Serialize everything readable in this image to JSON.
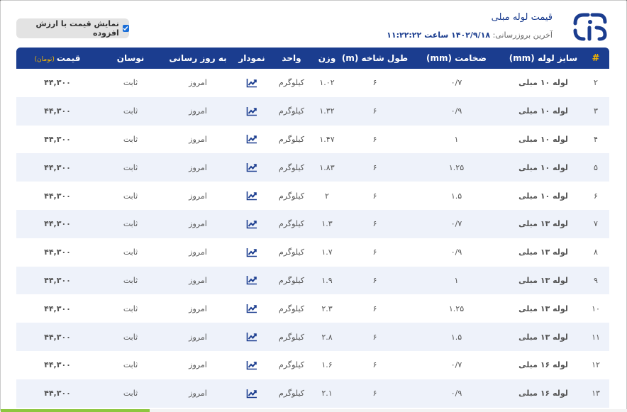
{
  "header": {
    "title": "قیمت لوله مبلی",
    "updated_label": "آخرین بروزرسانی:",
    "updated_value": "۱۴۰۲/۹/۱۸ ساعت ۱۱:۲۲:۲۲",
    "logo_icon": "company-logo-icon"
  },
  "vat_toggle": {
    "label": "نمایش قیمت با ارزش افزوده",
    "checked": true,
    "accent": "#1a6ed8"
  },
  "colors": {
    "header_bg": "#1b3d8f",
    "accent_yellow": "#f2b400",
    "row_alt": "#eef2fa",
    "chart_icon": "#1b3d8f"
  },
  "table": {
    "index_icon": "hash-icon",
    "columns": {
      "size": "سایز لوله (mm)",
      "thickness": "ضخامت (mm)",
      "length": "طول شاخه (m)",
      "weight": "وزن",
      "unit": "واحد",
      "chart": "نمودار",
      "update": "به روز رسانی",
      "change": "نوسان",
      "price": "قیمت",
      "price_unit": "(تومان)"
    },
    "rows": [
      {
        "idx": "۲",
        "size": "لوله ۱۰ مبلی",
        "thickness": "۰/۷",
        "length": "۶",
        "weight": "۱.۰۲",
        "unit": "کیلوگرم",
        "update": "امروز",
        "change": "ثابت",
        "price": "۴۴,۳۰۰"
      },
      {
        "idx": "۳",
        "size": "لوله ۱۰ مبلی",
        "thickness": "۰/۹",
        "length": "۶",
        "weight": "۱.۳۲",
        "unit": "کیلوگرم",
        "update": "امروز",
        "change": "ثابت",
        "price": "۴۴,۳۰۰"
      },
      {
        "idx": "۴",
        "size": "لوله ۱۰ مبلی",
        "thickness": "۱",
        "length": "۶",
        "weight": "۱.۴۷",
        "unit": "کیلوگرم",
        "update": "امروز",
        "change": "ثابت",
        "price": "۴۴,۳۰۰"
      },
      {
        "idx": "۵",
        "size": "لوله ۱۰ مبلی",
        "thickness": "۱.۲۵",
        "length": "۶",
        "weight": "۱.۸۳",
        "unit": "کیلوگرم",
        "update": "امروز",
        "change": "ثابت",
        "price": "۴۴,۳۰۰"
      },
      {
        "idx": "۶",
        "size": "لوله ۱۰ مبلی",
        "thickness": "۱.۵",
        "length": "۶",
        "weight": "۲",
        "unit": "کیلوگرم",
        "update": "امروز",
        "change": "ثابت",
        "price": "۴۴,۳۰۰"
      },
      {
        "idx": "۷",
        "size": "لوله ۱۳ مبلی",
        "thickness": "۰/۷",
        "length": "۶",
        "weight": "۱.۳",
        "unit": "کیلوگرم",
        "update": "امروز",
        "change": "ثابت",
        "price": "۴۴,۳۰۰"
      },
      {
        "idx": "۸",
        "size": "لوله ۱۳ مبلی",
        "thickness": "۰/۹",
        "length": "۶",
        "weight": "۱.۷",
        "unit": "کیلوگرم",
        "update": "امروز",
        "change": "ثابت",
        "price": "۴۴,۳۰۰"
      },
      {
        "idx": "۹",
        "size": "لوله ۱۳ مبلی",
        "thickness": "۱",
        "length": "۶",
        "weight": "۱.۹",
        "unit": "کیلوگرم",
        "update": "امروز",
        "change": "ثابت",
        "price": "۴۴,۳۰۰"
      },
      {
        "idx": "۱۰",
        "size": "لوله ۱۳ مبلی",
        "thickness": "۱.۲۵",
        "length": "۶",
        "weight": "۲.۳",
        "unit": "کیلوگرم",
        "update": "امروز",
        "change": "ثابت",
        "price": "۴۴,۳۰۰"
      },
      {
        "idx": "۱۱",
        "size": "لوله ۱۳ مبلی",
        "thickness": "۱.۵",
        "length": "۶",
        "weight": "۲.۸",
        "unit": "کیلوگرم",
        "update": "امروز",
        "change": "ثابت",
        "price": "۴۴,۳۰۰"
      },
      {
        "idx": "۱۲",
        "size": "لوله ۱۶ مبلی",
        "thickness": "۰/۷",
        "length": "۶",
        "weight": "۱.۶",
        "unit": "کیلوگرم",
        "update": "امروز",
        "change": "ثابت",
        "price": "۴۴,۳۰۰"
      },
      {
        "idx": "۱۳",
        "size": "لوله ۱۶ مبلی",
        "thickness": "۰/۹",
        "length": "۶",
        "weight": "۲.۱",
        "unit": "کیلوگرم",
        "update": "امروز",
        "change": "ثابت",
        "price": "۴۴,۳۰۰"
      }
    ]
  }
}
